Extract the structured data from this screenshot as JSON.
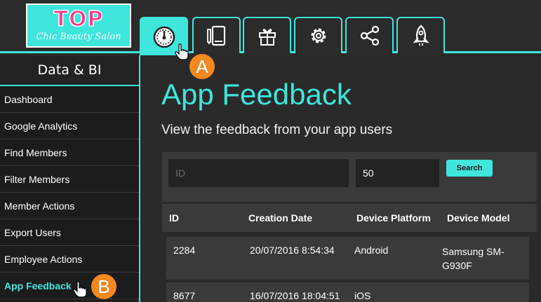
{
  "logo": {
    "title": "TOP",
    "subtitle": "Chic Beauty Salon"
  },
  "tabs": [
    {
      "icon": "dashboard-gauge-icon",
      "active": true
    },
    {
      "icon": "mobile-edit-icon"
    },
    {
      "icon": "gift-icon"
    },
    {
      "icon": "gear-icon"
    },
    {
      "icon": "share-icon"
    },
    {
      "icon": "rocket-icon"
    }
  ],
  "sidebar": {
    "title": "Data & BI",
    "items": [
      {
        "label": "Dashboard"
      },
      {
        "label": "Google Analytics"
      },
      {
        "label": "Find Members"
      },
      {
        "label": "Filter Members"
      },
      {
        "label": "Member Actions"
      },
      {
        "label": "Export Users"
      },
      {
        "label": "Employee Actions"
      },
      {
        "label": "App Feedback",
        "active": true
      }
    ]
  },
  "main": {
    "title": "App Feedback",
    "subtitle": "View the feedback from your app users",
    "filter": {
      "id_placeholder": "ID",
      "limit_value": "50",
      "search_label": "Search"
    },
    "table": {
      "columns": [
        "ID",
        "Creation Date",
        "Device Platform",
        "Device Model"
      ],
      "rows": [
        {
          "id": "2284",
          "date": "20/07/2016 8:54:34",
          "platform": "Android",
          "model": "Samsung SM-G930F"
        },
        {
          "id": "8677",
          "date": "16/07/2016 18:04:51",
          "platform": "iOS",
          "model": ""
        }
      ]
    }
  },
  "annotations": {
    "a": "A",
    "b": "B"
  },
  "colors": {
    "accent": "#3ee6dc",
    "marker": "#f5891f",
    "logo_text": "#ff3c8e"
  }
}
